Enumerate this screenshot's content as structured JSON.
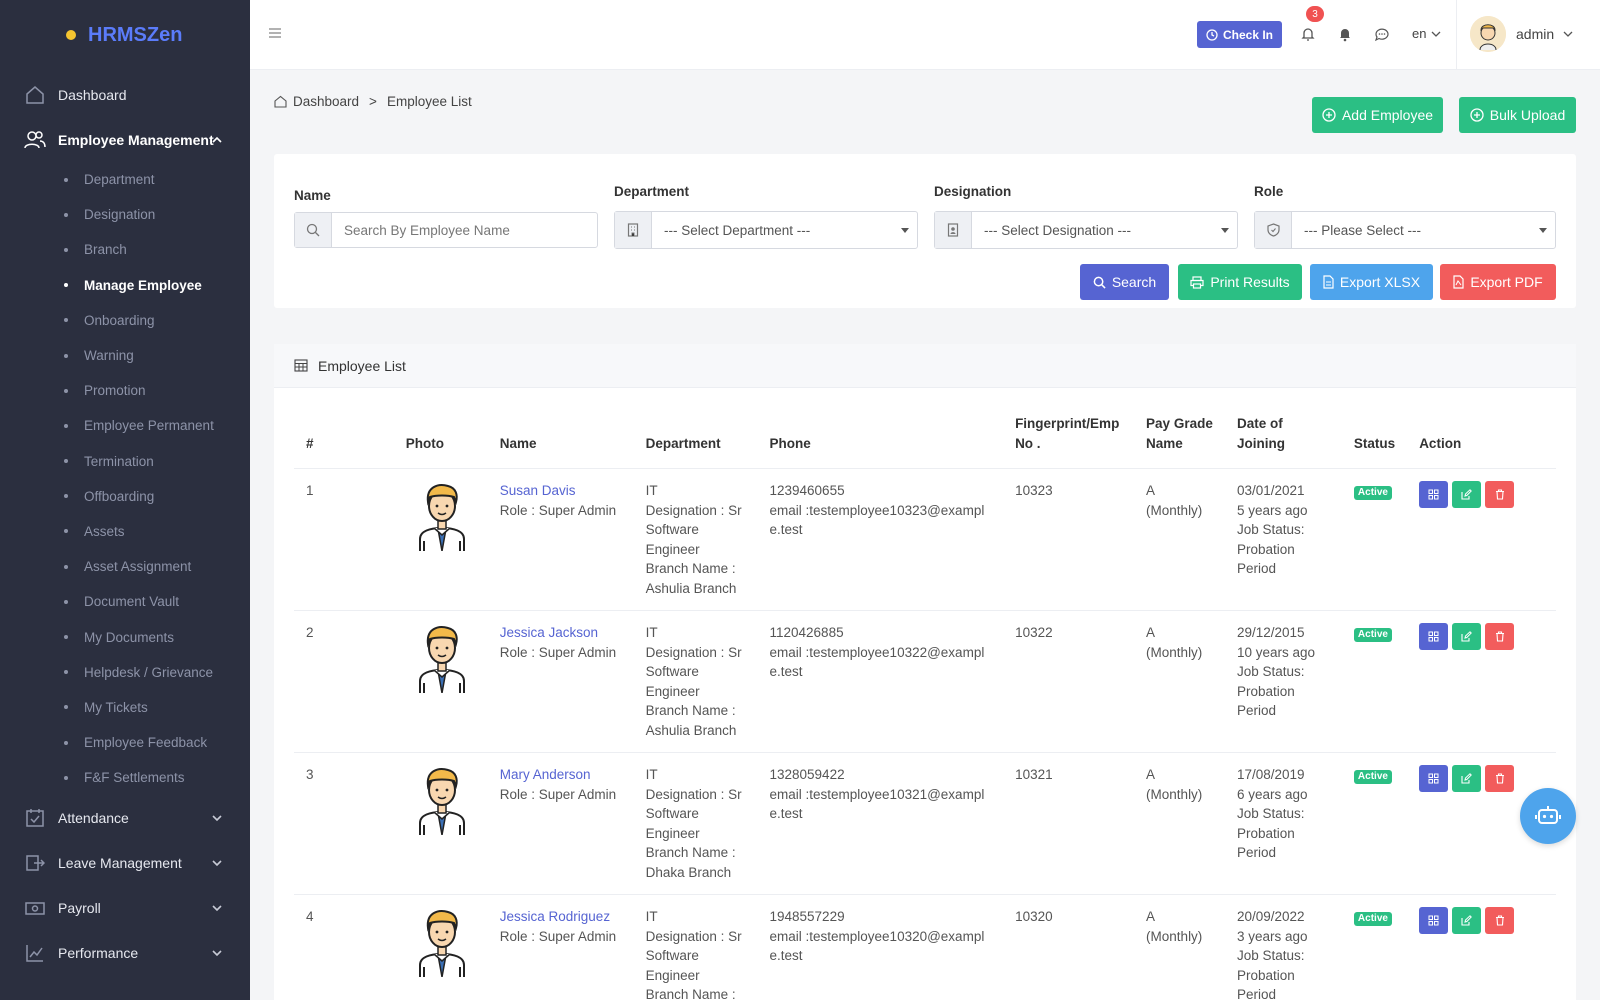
{
  "app": {
    "brand": "HRMSZen"
  },
  "sidebar": {
    "top_items": [
      {
        "label": "Dashboard"
      },
      {
        "label": "Employee Management"
      }
    ],
    "sub_items": [
      {
        "label": "Department"
      },
      {
        "label": "Designation"
      },
      {
        "label": "Branch"
      },
      {
        "label": "Manage Employee"
      },
      {
        "label": "Onboarding"
      },
      {
        "label": "Warning"
      },
      {
        "label": "Promotion"
      },
      {
        "label": "Employee Permanent"
      },
      {
        "label": "Termination"
      },
      {
        "label": "Offboarding"
      },
      {
        "label": "Assets"
      },
      {
        "label": "Asset Assignment"
      },
      {
        "label": "Document Vault"
      },
      {
        "label": "My Documents"
      },
      {
        "label": "Helpdesk / Grievance"
      },
      {
        "label": "My Tickets"
      },
      {
        "label": "Employee Feedback"
      },
      {
        "label": "F&F Settlements"
      }
    ],
    "bottom_items": [
      {
        "label": "Attendance"
      },
      {
        "label": "Leave Management"
      },
      {
        "label": "Payroll"
      },
      {
        "label": "Performance"
      }
    ]
  },
  "topbar": {
    "checkin_label": "Check In",
    "notification_count": "3",
    "language": "en",
    "username": "admin"
  },
  "breadcrumb": {
    "home": "Dashboard",
    "separator": ">",
    "current": "Employee List"
  },
  "actions": {
    "add_employee": "Add Employee",
    "bulk_upload": "Bulk Upload"
  },
  "filters": {
    "name_label": "Name",
    "name_placeholder": "Search By Employee Name",
    "department_label": "Department",
    "department_value": "--- Select Department ---",
    "designation_label": "Designation",
    "designation_value": "--- Select Designation ---",
    "role_label": "Role",
    "role_value": "--- Please Select ---",
    "search_btn": "Search",
    "print_btn": "Print Results",
    "xlsx_btn": "Export XLSX",
    "pdf_btn": "Export PDF"
  },
  "list": {
    "title": "Employee List",
    "columns": [
      "#",
      "Photo",
      "Name",
      "Department",
      "Phone",
      "Fingerprint/Emp No .",
      "Pay Grade Name",
      "Date of Joining",
      "Status",
      "Action"
    ],
    "rows": [
      {
        "num": "1",
        "name": "Susan Davis",
        "role": "Role : Super Admin",
        "dept": "IT",
        "designation": "Designation : Sr Software Engineer",
        "branch": "Branch Name : Ashulia Branch",
        "phone": "1239460655",
        "email": "email :testemployee10323@example.test",
        "emp_no": "10323",
        "pay_grade": "A (Monthly)",
        "doj": "03/01/2021",
        "ago": "5 years ago",
        "job_status": "Job Status: Probation Period",
        "status": "Active"
      },
      {
        "num": "2",
        "name": "Jessica Jackson",
        "role": "Role : Super Admin",
        "dept": "IT",
        "designation": "Designation : Sr Software Engineer",
        "branch": "Branch Name : Ashulia Branch",
        "phone": "1120426885",
        "email": "email :testemployee10322@example.test",
        "emp_no": "10322",
        "pay_grade": "A (Monthly)",
        "doj": "29/12/2015",
        "ago": "10 years ago",
        "job_status": "Job Status: Probation Period",
        "status": "Active"
      },
      {
        "num": "3",
        "name": "Mary Anderson",
        "role": "Role : Super Admin",
        "dept": "IT",
        "designation": "Designation : Sr Software Engineer",
        "branch": "Branch Name : Dhaka Branch",
        "phone": "1328059422",
        "email": "email :testemployee10321@example.test",
        "emp_no": "10321",
        "pay_grade": "A (Monthly)",
        "doj": "17/08/2019",
        "ago": "6 years ago",
        "job_status": "Job Status: Probation Period",
        "status": "Active"
      },
      {
        "num": "4",
        "name": "Jessica Rodriguez",
        "role": "Role : Super Admin",
        "dept": "IT",
        "designation": "Designation : Sr Software Engineer",
        "branch": "Branch Name :",
        "phone": "1948557229",
        "email": "email :testemployee10320@example.test",
        "emp_no": "10320",
        "pay_grade": "A (Monthly)",
        "doj": "20/09/2022",
        "ago": "3 years ago",
        "job_status": "Job Status: Probation Period",
        "status": "Active"
      }
    ]
  }
}
